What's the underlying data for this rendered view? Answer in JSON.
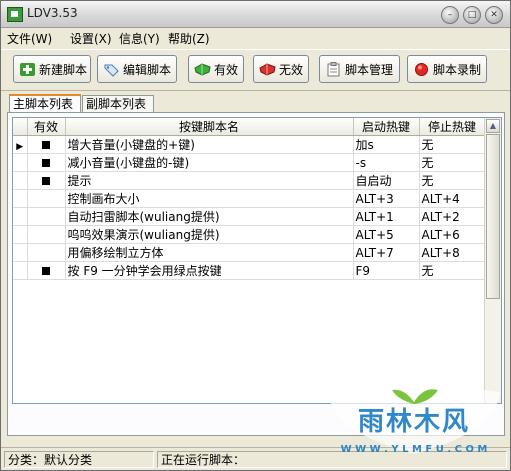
{
  "window": {
    "title": "LDV3.53"
  },
  "menu": [
    "文件(W)",
    "设置(X)",
    "信息(Y)",
    "帮助(Z)"
  ],
  "toolbar": [
    {
      "label": "新建脚本",
      "icon": "plus-icon"
    },
    {
      "label": "编辑脚本",
      "icon": "tag-icon"
    },
    {
      "label": "有效",
      "icon": "green-gem-icon"
    },
    {
      "label": "无效",
      "icon": "red-gem-icon"
    },
    {
      "label": "脚本管理",
      "icon": "clipboard-icon"
    },
    {
      "label": "脚本录制",
      "icon": "record-icon"
    }
  ],
  "tabs": [
    "主脚本列表",
    "副脚本列表"
  ],
  "table": {
    "headers": [
      "有效",
      "按键脚本名",
      "启动热键",
      "停止热键"
    ],
    "rows": [
      {
        "active": true,
        "current": true,
        "name": "增大音量(小键盘的+键)",
        "start": "加s",
        "stop": "无"
      },
      {
        "active": true,
        "current": false,
        "name": "减小音量(小键盘的-键)",
        "start": "-s",
        "stop": "无"
      },
      {
        "active": true,
        "current": false,
        "name": "提示",
        "start": "自启动",
        "stop": "无"
      },
      {
        "active": false,
        "current": false,
        "name": "控制画布大小",
        "start": "ALT+3",
        "stop": "ALT+4"
      },
      {
        "active": false,
        "current": false,
        "name": "自动扫雷脚本(wuliang提供)",
        "start": "ALT+1",
        "stop": "ALT+2"
      },
      {
        "active": false,
        "current": false,
        "name": "呜呜效果演示(wuliang提供)",
        "start": "ALT+5",
        "stop": "ALT+6"
      },
      {
        "active": false,
        "current": false,
        "name": "用偏移绘制立方体",
        "start": "ALT+7",
        "stop": "ALT+8"
      },
      {
        "active": true,
        "current": false,
        "name": "按 F9 一分钟学会用绿点按键",
        "start": "F9",
        "stop": "无"
      }
    ]
  },
  "status": {
    "category": "分类：默认分类",
    "running": "正在运行脚本："
  },
  "watermark": {
    "brand": "雨林木风",
    "url": "W W W . Y L M F U . C O M"
  },
  "colors": {
    "accent": "#e68b2c",
    "watermark_blue": "#1f7fc4",
    "watermark_green": "#6fbf2e"
  }
}
